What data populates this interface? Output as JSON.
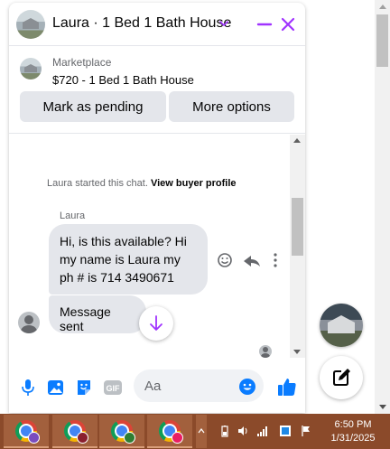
{
  "chat": {
    "title": "Laura · 1 Bed 1 Bath House",
    "marketplace": {
      "source": "Marketplace",
      "listing": "$720 - 1 Bed 1 Bath House",
      "mark_pending_label": "Mark as pending",
      "more_options_label": "More options"
    },
    "messages": {
      "started_prefix": "Laura started this chat.",
      "view_profile_label": "View buyer profile",
      "sender_name": "Laura",
      "incoming_text": "Hi, is this available? Hi my name is Laura  my ph # is 714 3490671",
      "outgoing_text": "Message sent"
    },
    "composer": {
      "placeholder": "Aa",
      "icons": [
        "microphone-icon",
        "photo-icon",
        "sticker-icon",
        "gif-icon",
        "emoji-icon",
        "like-icon"
      ]
    },
    "colors": {
      "accent": "#a033ff",
      "messenger_blue": "#0a7cff"
    }
  },
  "taskbar": {
    "apps": [
      "chrome",
      "chrome",
      "chrome",
      "chrome"
    ],
    "time": "6:50 PM",
    "date": "1/31/2025",
    "background": "#8b4a2a"
  }
}
